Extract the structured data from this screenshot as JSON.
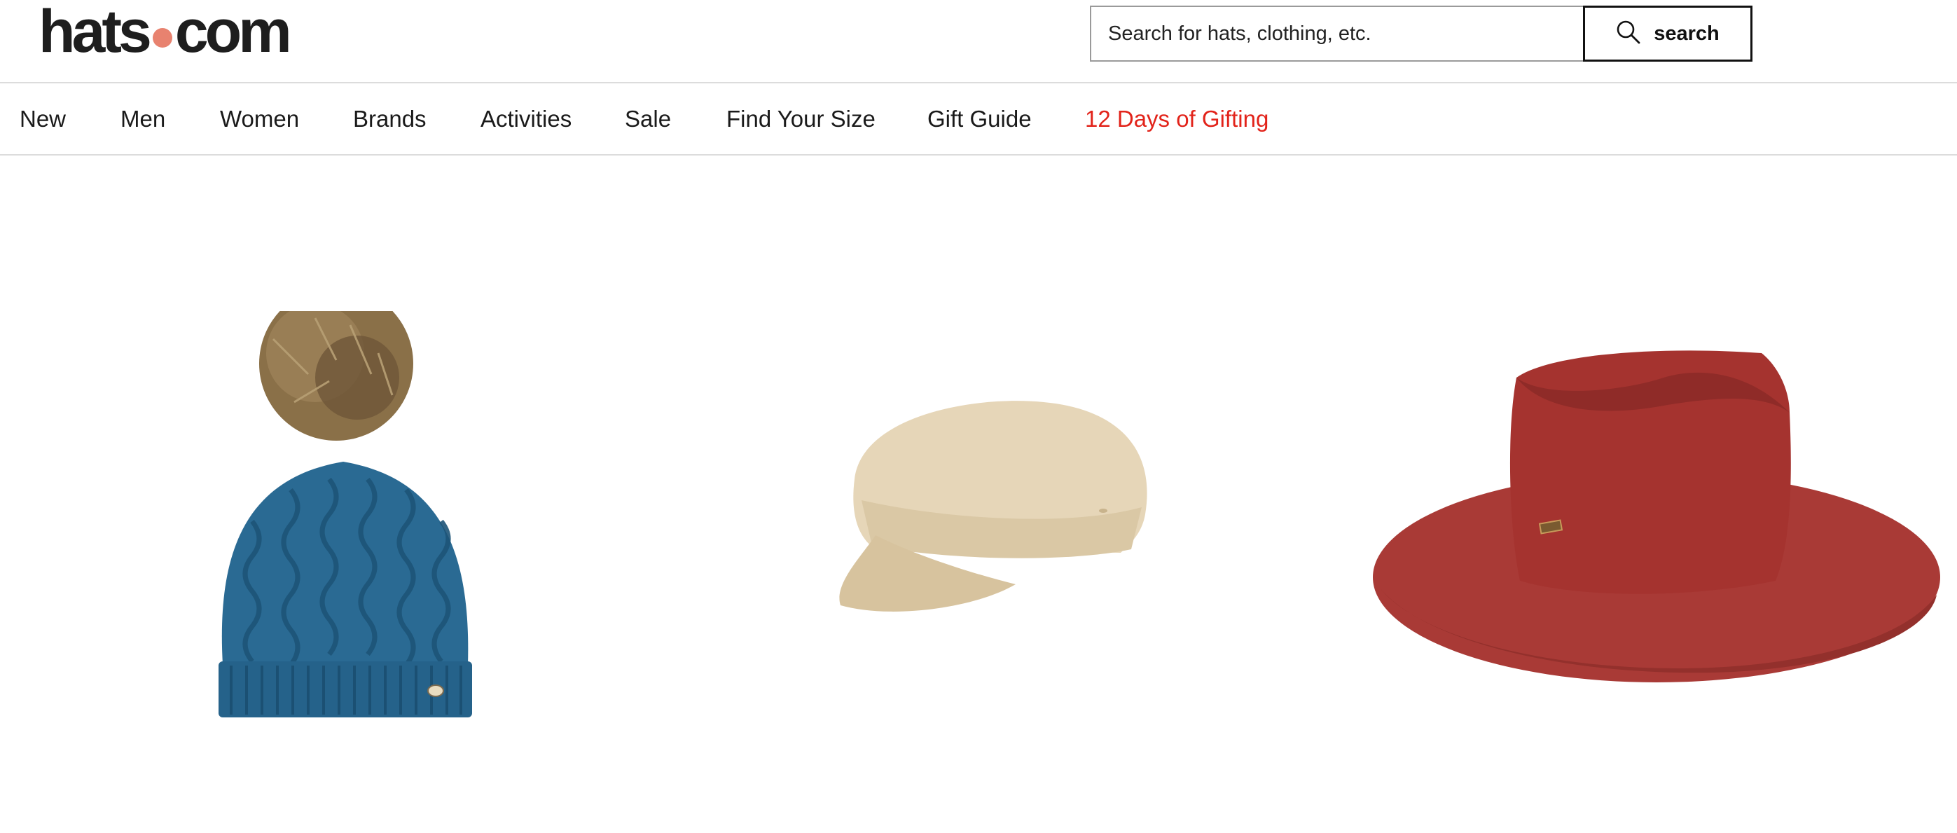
{
  "header": {
    "logo": {
      "left": "hats",
      "right": "com",
      "dot_color": "#e8826f"
    },
    "search": {
      "placeholder": "Search for hats, clothing, etc.",
      "value": "",
      "button_label": "search",
      "button_icon": "search-icon"
    }
  },
  "nav": {
    "items": [
      {
        "label": "New"
      },
      {
        "label": "Men"
      },
      {
        "label": "Women"
      },
      {
        "label": "Brands"
      },
      {
        "label": "Activities"
      },
      {
        "label": "Sale"
      },
      {
        "label": "Find Your Size"
      },
      {
        "label": "Gift Guide"
      },
      {
        "label": "12 Days of Gifting",
        "color": "#e2231a"
      }
    ]
  },
  "products": [
    {
      "image": "blue-cable-knit-beanie-with-pom",
      "color": "#2a6a93"
    },
    {
      "image": "beige-wool-newsboy-cap",
      "color": "#e6d6b8"
    },
    {
      "image": "red-wide-brim-fedora",
      "color": "#a93a36"
    }
  ]
}
